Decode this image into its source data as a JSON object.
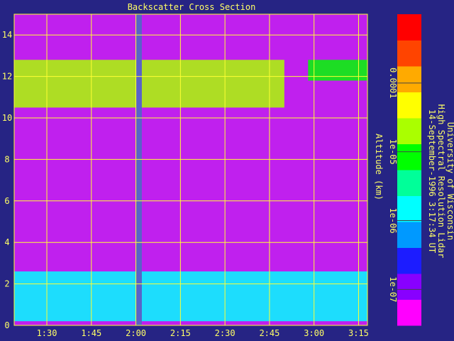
{
  "chart_data": {
    "type": "heatmap",
    "title": "Backscatter Cross Section",
    "ylabel": "Altitude (km)",
    "xlabel": "",
    "x_ticks": [
      "1:30",
      "1:45",
      "2:00",
      "2:15",
      "2:30",
      "2:45",
      "3:00",
      "3:15"
    ],
    "x_tick_values_min": [
      90,
      105,
      120,
      135,
      150,
      165,
      180,
      195
    ],
    "xlim_min": [
      79,
      198
    ],
    "y_ticks": [
      0,
      2,
      4,
      6,
      8,
      10,
      12,
      14
    ],
    "ylim": [
      0,
      15
    ],
    "grid": true,
    "colorbar": {
      "scale": "log",
      "range": [
        3e-08,
        0.001
      ],
      "tick_labels": [
        "0.0001",
        "1e-05",
        "1e-06",
        "1e-07"
      ],
      "tick_values": [
        0.0001,
        1e-05,
        1e-06,
        1e-07
      ],
      "colormap": [
        "#ff00ff",
        "#8800ff",
        "#1c1cff",
        "#0099ff",
        "#00ffff",
        "#00ff99",
        "#00ff00",
        "#aaff00",
        "#ffff00",
        "#ffaa00",
        "#ff4400",
        "#ff0000"
      ]
    },
    "features": [
      {
        "label": "boundary layer",
        "alt_km": [
          0.2,
          2.6
        ],
        "time_min": [
          79,
          198
        ],
        "level": 2.2e-06
      },
      {
        "label": "cirrus layer",
        "alt_km": [
          10.5,
          12.8
        ],
        "time_min": [
          79,
          170
        ],
        "level": 2.5e-05
      },
      {
        "label": "cirrus patch",
        "alt_km": [
          11.8,
          12.8
        ],
        "time_min": [
          178,
          198
        ],
        "level": 1.2e-05
      },
      {
        "label": "data gap",
        "alt_km": [
          0,
          15
        ],
        "time_min": [
          120,
          122
        ],
        "level": null
      }
    ],
    "side_text": [
      "University of Wisconsin",
      "High Spectral Resolution Lidar",
      "14-September-1996  3:17:34 UT"
    ]
  },
  "colors": {
    "background": "#262484",
    "grid": "#ffff33",
    "axis_text": "#ffff66",
    "data_gap": "#5a62c8"
  }
}
